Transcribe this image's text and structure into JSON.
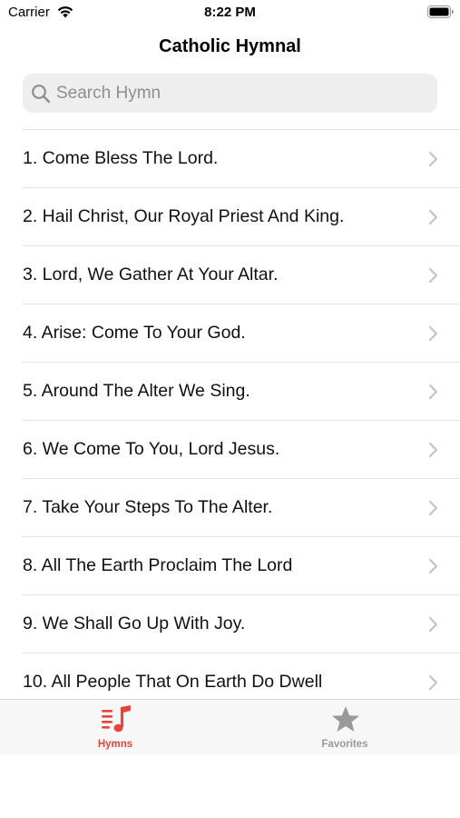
{
  "status_bar": {
    "carrier": "Carrier",
    "time": "8:22 PM"
  },
  "nav": {
    "title": "Catholic Hymnal"
  },
  "search": {
    "placeholder": "Search Hymn",
    "value": ""
  },
  "hymns": [
    {
      "label": "1. Come Bless The Lord."
    },
    {
      "label": "2. Hail Christ, Our Royal Priest And King."
    },
    {
      "label": "3. Lord, We Gather At Your Altar."
    },
    {
      "label": "4. Arise: Come To Your God."
    },
    {
      "label": "5. Around The Alter We Sing."
    },
    {
      "label": "6. We Come To You, Lord Jesus."
    },
    {
      "label": "7. Take Your Steps To The Alter."
    },
    {
      "label": "8. All The Earth Proclaim The Lord"
    },
    {
      "label": "9. We Shall Go Up With Joy."
    },
    {
      "label": "10. All People That On Earth Do Dwell"
    }
  ],
  "tab_bar": {
    "tabs": [
      {
        "label": "Hymns",
        "icon": "music-note-list-icon",
        "selected": true
      },
      {
        "label": "Favorites",
        "icon": "star-icon",
        "selected": false
      }
    ]
  },
  "colors": {
    "accent": "#e8433a",
    "inactive": "#9a9a9e",
    "search_bg": "#eeeeef",
    "separator": "#e4e4e6"
  }
}
